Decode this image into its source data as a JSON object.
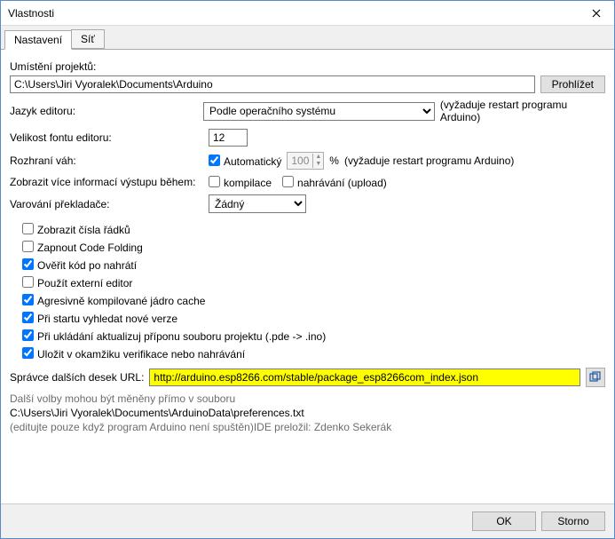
{
  "window": {
    "title": "Vlastnosti"
  },
  "tabs": {
    "settings": "Nastavení",
    "network": "Síť"
  },
  "sketchbook": {
    "label": "Umístění projektů:",
    "path": "C:\\Users\\Jiri Vyoralek\\Documents\\Arduino",
    "browse": "Prohlížet"
  },
  "language": {
    "label": "Jazyk editoru:",
    "value": "Podle operačního systému",
    "note": "(vyžaduje restart programu Arduino)"
  },
  "fontsize": {
    "label": "Velikost fontu editoru:",
    "value": "12"
  },
  "scale": {
    "label": "Rozhraní váh:",
    "auto_label": "Automatický",
    "value": "100",
    "pct": "%",
    "note": "(vyžaduje restart programu Arduino)"
  },
  "verbose": {
    "label": "Zobrazit více informací výstupu během:",
    "compile": "kompilace",
    "upload": "nahrávání (upload)"
  },
  "warnings": {
    "label": "Varování překladače:",
    "value": "Žádný"
  },
  "checks": {
    "line_numbers": "Zobrazit čísla řádků",
    "code_folding": "Zapnout Code Folding",
    "verify_after_upload": "Ověřit kód po nahrátí",
    "external_editor": "Použít externí editor",
    "aggressive_cache": "Agresivně kompilované jádro cache",
    "check_updates": "Při startu vyhledat nové verze",
    "update_ext": "Při ukládání aktualizuj příponu souboru projektu (.pde -> .ino)",
    "save_on_verify": "Uložit v okamžiku verifikace nebo nahrávání"
  },
  "boards": {
    "label": "Správce dalších desek URL:",
    "url": "http://arduino.esp8266.com/stable/package_esp8266com_index.json"
  },
  "more": {
    "line1": "Další volby mohou být měněny přímo v souboru",
    "line2": "C:\\Users\\Jiri Vyoralek\\Documents\\ArduinoData\\preferences.txt",
    "line3": "(editujte pouze když program Arduino není spuštěn)IDE preložil: Zdenko Sekerák"
  },
  "buttons": {
    "ok": "OK",
    "cancel": "Storno"
  }
}
